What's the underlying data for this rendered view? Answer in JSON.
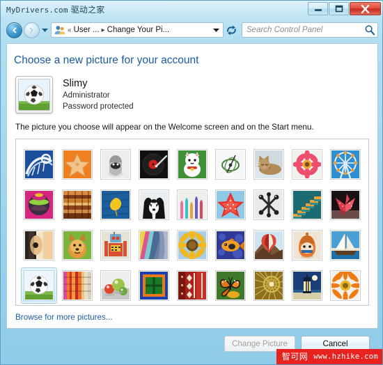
{
  "window": {
    "watermark_top_latin": "MyDrivers.com",
    "watermark_top_cn": "驱动之家",
    "watermark_bottom_cn": "智可网",
    "watermark_bottom_url": "www.hzhike.com",
    "minimize_label": "Minimize",
    "maximize_label": "Maximize",
    "close_label": "Close"
  },
  "nav": {
    "back_label": "Back",
    "forward_label": "Forward",
    "history_label": "Recent pages",
    "breadcrumb": {
      "overflow": "«",
      "segments": [
        "User ...",
        "Change Your Pi..."
      ],
      "separator": "▸"
    },
    "refresh_label": "Refresh",
    "address_dropdown_label": "Previous locations"
  },
  "search": {
    "placeholder": "Search Control Panel",
    "value": ""
  },
  "main": {
    "page_title": "Choose a new picture for your account",
    "account": {
      "name": "Slimy",
      "role": "Administrator",
      "protection": "Password protected",
      "avatar_name": "soccer-ball"
    },
    "description": "The picture you choose will appear on the Welcome screen and on the Start menu.",
    "browse_link": "Browse for more pictures..."
  },
  "pictures": {
    "selected_index": 27,
    "items": [
      {
        "name": "roller-coaster",
        "row": 1,
        "col": 1
      },
      {
        "name": "starfish-orange",
        "row": 1,
        "col": 2
      },
      {
        "name": "robot-mascot",
        "row": 1,
        "col": 3
      },
      {
        "name": "record-turntable",
        "row": 1,
        "col": 4
      },
      {
        "name": "lucky-cat",
        "row": 1,
        "col": 5
      },
      {
        "name": "gyroscope",
        "row": 1,
        "col": 6
      },
      {
        "name": "kitten",
        "row": 1,
        "col": 7
      },
      {
        "name": "pink-gerbera",
        "row": 1,
        "col": 8
      },
      {
        "name": "ferris-wheel",
        "row": 1,
        "col": 9
      },
      {
        "name": "striped-ball",
        "row": 2,
        "col": 1
      },
      {
        "name": "woven-textile",
        "row": 2,
        "col": 2
      },
      {
        "name": "yellow-leaf",
        "row": 2,
        "col": 3
      },
      {
        "name": "border-collie",
        "row": 2,
        "col": 4
      },
      {
        "name": "colored-bottles",
        "row": 2,
        "col": 5
      },
      {
        "name": "red-star-flower",
        "row": 2,
        "col": 6
      },
      {
        "name": "metal-jacks",
        "row": 2,
        "col": 7
      },
      {
        "name": "orange-stairs",
        "row": 2,
        "col": 8
      },
      {
        "name": "origami-crane",
        "row": 2,
        "col": 9
      },
      {
        "name": "acoustic-guitar",
        "row": 3,
        "col": 1
      },
      {
        "name": "pomeranian-dog",
        "row": 3,
        "col": 2
      },
      {
        "name": "toy-robot",
        "row": 3,
        "col": 3
      },
      {
        "name": "draped-fabric",
        "row": 3,
        "col": 4
      },
      {
        "name": "sunflower",
        "row": 3,
        "col": 5
      },
      {
        "name": "tropical-fish",
        "row": 3,
        "col": 6
      },
      {
        "name": "hot-air-balloon",
        "row": 3,
        "col": 7
      },
      {
        "name": "daruma-doll",
        "row": 3,
        "col": 8
      },
      {
        "name": "sailboat",
        "row": 3,
        "col": 9
      },
      {
        "name": "soccer-ball",
        "row": 4,
        "col": 1
      },
      {
        "name": "striped-cloth",
        "row": 4,
        "col": 2
      },
      {
        "name": "glass-marbles",
        "row": 4,
        "col": 3
      },
      {
        "name": "green-window",
        "row": 4,
        "col": 4
      },
      {
        "name": "red-carpet-weave",
        "row": 4,
        "col": 5
      },
      {
        "name": "monarch-butterfly",
        "row": 4,
        "col": 6
      },
      {
        "name": "golden-spiral",
        "row": 4,
        "col": 7
      },
      {
        "name": "lantern-night",
        "row": 4,
        "col": 8
      },
      {
        "name": "orange-gerbera",
        "row": 4,
        "col": 9
      }
    ]
  },
  "buttons": {
    "change_picture": "Change Picture",
    "change_picture_enabled": false,
    "cancel": "Cancel"
  },
  "colors": {
    "frame": "#9ed2ec",
    "accent_link": "#1c5fa8",
    "title_blue": "#1a5b9e",
    "close_red": "#c62b1d",
    "watermark_red": "#e8231f"
  }
}
